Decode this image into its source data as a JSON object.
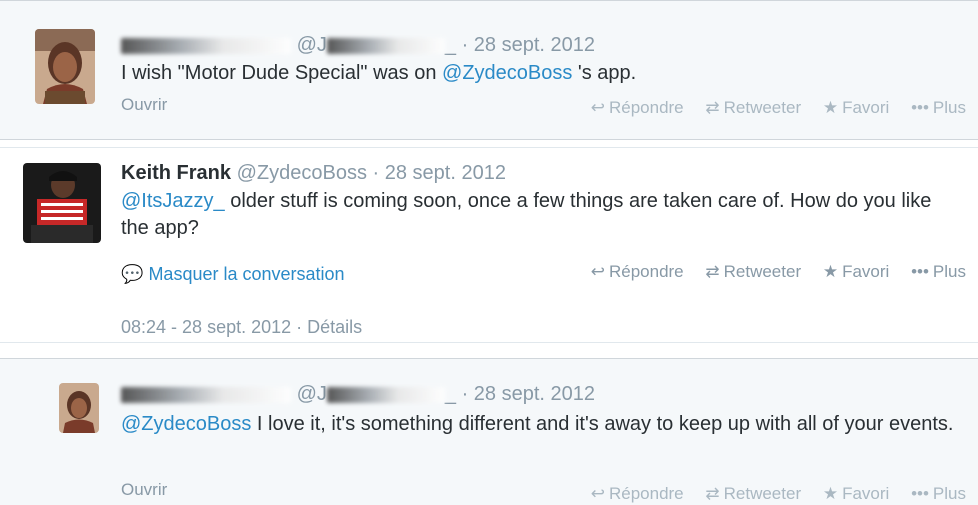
{
  "tweets": [
    {
      "handle_prefix": "@J",
      "handle_suffix": "_",
      "separator": "·",
      "date": "28 sept. 2012",
      "text_before": "I wish \"Motor Dude Special\" was on ",
      "mention": "@ZydecoBoss",
      "text_after": " 's app.",
      "open_label": "Ouvrir"
    },
    {
      "name": "Keith Frank",
      "handle": "@ZydecoBoss",
      "separator": "·",
      "date": "28 sept. 2012",
      "mention": "@ItsJazzy_",
      "text_after": " older stuff is coming soon, once a few things are taken care of. How do you like the app?",
      "conversation_label": "Masquer la conversation",
      "timestamp": "08:24 - 28 sept. 2012 · Détails"
    },
    {
      "handle_prefix": "@J",
      "handle_suffix": "_",
      "separator": "·",
      "date": "28 sept. 2012",
      "mention": "@ZydecoBoss",
      "text_after": " I love it, it's something different and it's away to keep up with all of your events.",
      "open_label": "Ouvrir"
    }
  ],
  "actions": {
    "reply": "Répondre",
    "retweet": "Retweeter",
    "favorite": "Favori",
    "more": "Plus"
  },
  "icons": {
    "reply": "reply-arrow-icon",
    "retweet": "retweet-icon",
    "favorite": "star-icon",
    "more": "ellipsis-icon",
    "conversation": "speech-bubble-icon"
  },
  "colors": {
    "link": "#2a8ac7",
    "muted": "#8899a6",
    "faded_actions": "#aab8c2",
    "highlight_bg": "#f5f8fa"
  }
}
